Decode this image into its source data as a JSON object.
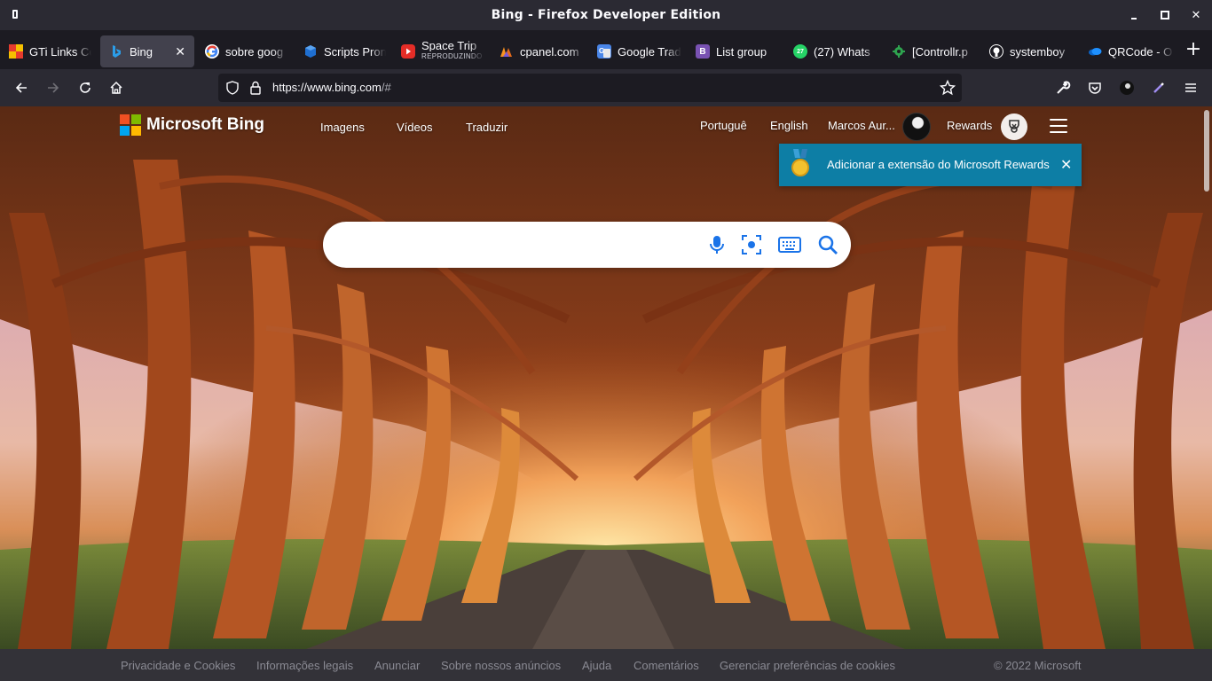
{
  "window": {
    "title": "Bing - Firefox Developer Edition",
    "minimize_glyph": "",
    "close_glyph": "✕"
  },
  "tabs": [
    {
      "label": "GTi Links Co",
      "favicon": "gti-icon",
      "active": false
    },
    {
      "label": "Bing",
      "favicon": "bing-icon",
      "active": true
    },
    {
      "label": "sobre goog",
      "favicon": "google-icon",
      "active": false
    },
    {
      "label": "Scripts Pron",
      "favicon": "scripts-icon",
      "active": false
    },
    {
      "label": "Space Trip",
      "sublabel": "REPRODUZINDO",
      "favicon": "youtube-icon",
      "active": false
    },
    {
      "label": "cpanel.com",
      "favicon": "cpanel-icon",
      "active": false
    },
    {
      "label": "Google Trad",
      "favicon": "google-translate-icon",
      "active": false
    },
    {
      "label": "List group",
      "favicon": "bootstrap-icon",
      "active": false
    },
    {
      "label": "(27) Whats",
      "favicon": "whatsapp-icon",
      "badge": "27",
      "active": false
    },
    {
      "label": "[Controllr.p",
      "favicon": "controllr-icon",
      "active": false
    },
    {
      "label": "systemboy",
      "favicon": "github-icon",
      "active": false
    },
    {
      "label": "QRCode - O",
      "favicon": "onedrive-icon",
      "active": false
    }
  ],
  "tab_close_glyph": "✕",
  "new_tab_glyph": "+",
  "navbar": {
    "url_host": "https://www.bing.com",
    "url_path": "/#"
  },
  "bing": {
    "brand": "Microsoft Bing",
    "nav": [
      "Imagens",
      "Vídeos",
      "Traduzir"
    ],
    "lang_pt": "Portuguê",
    "lang_en": "English",
    "user_name": "Marcos Aur...",
    "rewards_label": "Rewards",
    "popup_text": "Adicionar a extensão do Microsoft Rewards",
    "popup_close": "✕",
    "search_value": "",
    "colors": {
      "ms_red": "#f25022",
      "ms_green": "#7fba00",
      "ms_blue": "#00a4ef",
      "ms_yellow": "#ffb900",
      "popup_bg": "#0d7ea5",
      "search_icon": "#1a73e8"
    }
  },
  "footer": {
    "links": [
      "Privacidade e Cookies",
      "Informações legais",
      "Anunciar",
      "Sobre nossos anúncios",
      "Ajuda",
      "Comentários",
      "Gerenciar preferências de cookies"
    ],
    "copyright": "© 2022 Microsoft"
  }
}
